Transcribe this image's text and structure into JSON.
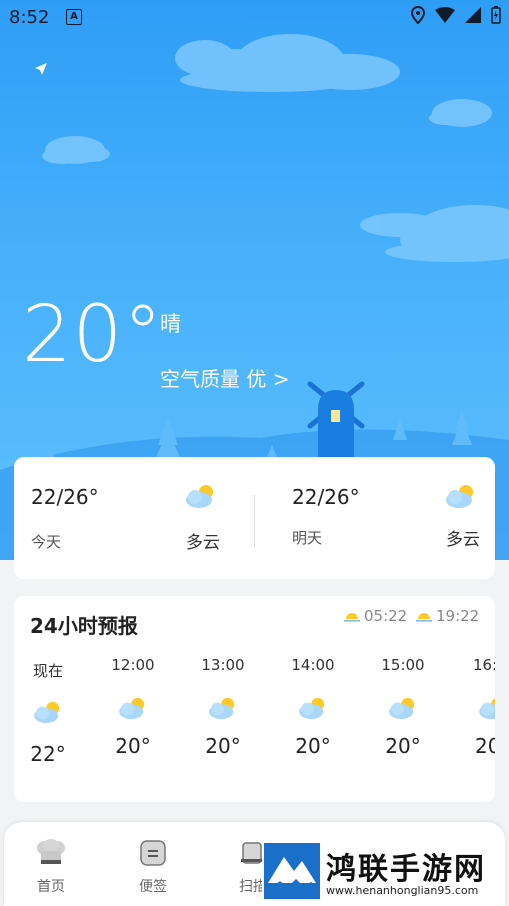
{
  "status": {
    "time": "8:52",
    "a_badge": "A"
  },
  "current": {
    "temp": "20°",
    "condition": "晴",
    "aqi_label": "空气质量 优 >"
  },
  "daily": [
    {
      "range": "22/26°",
      "day": "今天",
      "condition": "多云",
      "icon": "partly-cloudy-icon"
    },
    {
      "range": "22/26°",
      "day": "明天",
      "condition": "多云",
      "icon": "partly-cloudy-icon"
    }
  ],
  "hourly": {
    "title": "24小时预报",
    "sunrise": "05:22",
    "sunset": "19:22",
    "items": [
      {
        "time": "现在",
        "temp": "22°"
      },
      {
        "time": "12:00",
        "temp": "20°"
      },
      {
        "time": "13:00",
        "temp": "20°"
      },
      {
        "time": "14:00",
        "temp": "20°"
      },
      {
        "time": "15:00",
        "temp": "20°"
      },
      {
        "time": "16:",
        "temp": "20"
      }
    ]
  },
  "tabs": [
    {
      "label": "首页",
      "icon": "chef-hat-icon"
    },
    {
      "label": "便签",
      "icon": "note-icon"
    },
    {
      "label": "扫描",
      "icon": "scan-icon"
    }
  ],
  "watermark": {
    "title": "鸿联手游网",
    "url": "www.henanhonglian95.com"
  },
  "colors": {
    "sky_top": "#2e9df6",
    "sky_bottom": "#5ec0fd",
    "card": "#ffffff"
  }
}
